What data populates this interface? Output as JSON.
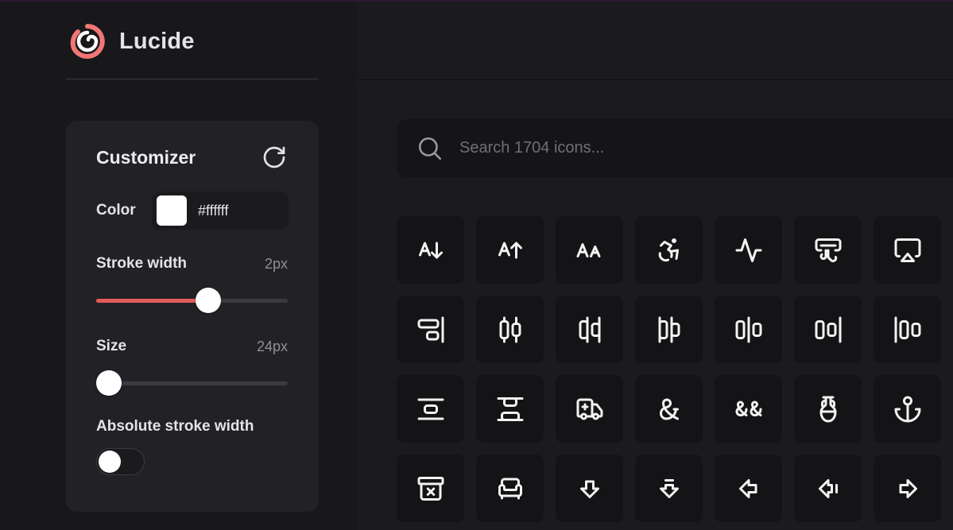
{
  "brand": {
    "name": "Lucide",
    "accent": "#e45c5c"
  },
  "customizer": {
    "title": "Customizer",
    "reset_icon": "rotate-cw-icon",
    "color": {
      "label": "Color",
      "value": "#ffffff"
    },
    "stroke_width": {
      "label": "Stroke width",
      "value": "2px",
      "level_fraction": 0.6
    },
    "size": {
      "label": "Size",
      "value": "24px",
      "level_fraction": 0.0
    },
    "absolute_stroke": {
      "label": "Absolute stroke width",
      "enabled": false
    }
  },
  "search": {
    "placeholder": "Search 1704 icons..."
  },
  "icons": [
    [
      "a-arrow-down",
      "a-arrow-up",
      "a-large-small",
      "accessibility",
      "activity",
      "air-vent",
      "airplay"
    ],
    [
      "align-end-vertical",
      "align-horizontal-distribute-center",
      "align-horizontal-distribute-end",
      "align-horizontal-distribute-start",
      "align-horizontal-justify-center",
      "align-horizontal-justify-end",
      "align-horizontal-justify-start"
    ],
    [
      "align-vertical-space-around",
      "align-vertical-space-between",
      "ambulance",
      "ampersand",
      "ampersands",
      "amphora",
      "anchor"
    ],
    [
      "archive-x",
      "armchair",
      "arrow-big-down",
      "arrow-big-down-dash",
      "arrow-big-left",
      "arrow-big-left-dash",
      "arrow-big-right"
    ]
  ]
}
